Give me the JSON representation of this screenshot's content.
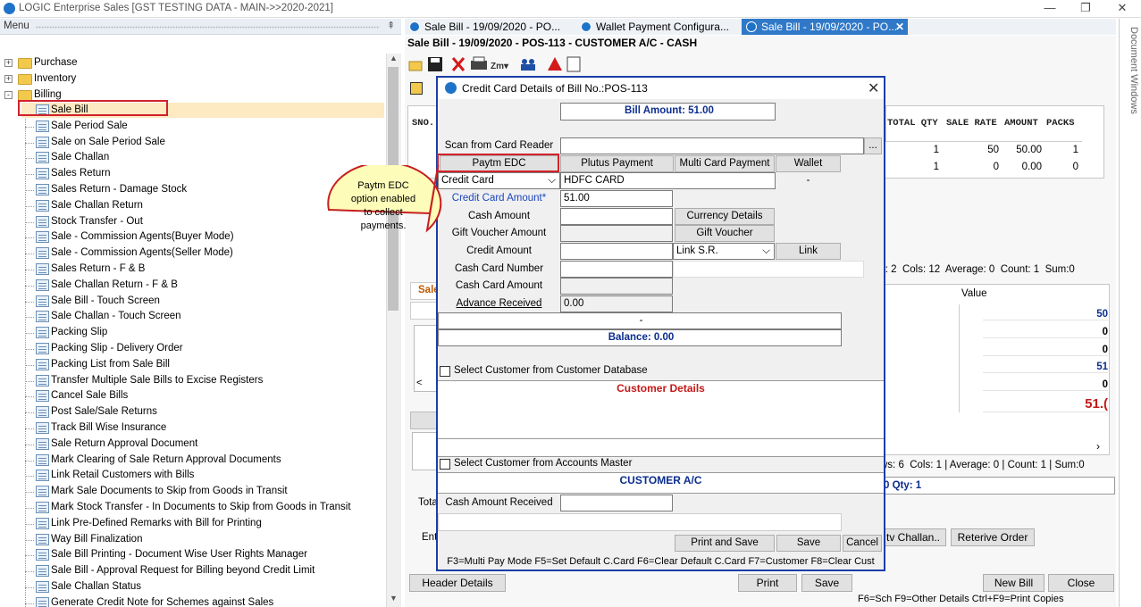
{
  "window": {
    "title": "LOGIC Enterprise Sales  [GST TESTING DATA - MAIN->>2020-2021]",
    "min": "—",
    "max": "❐",
    "close": "✕"
  },
  "menu": {
    "header": "Menu",
    "pin": "⇞",
    "groups": [
      {
        "label": "Purchase",
        "expander": "+"
      },
      {
        "label": "Inventory",
        "expander": "+"
      },
      {
        "label": "Billing",
        "expander": "-"
      }
    ],
    "items": [
      "Sale Bill",
      "Sale Period Sale",
      "Sale on Sale Period Sale",
      "Sale Challan",
      "Sales Return",
      "Sales Return - Damage Stock",
      "Sale Challan Return",
      "Stock Transfer - Out",
      "Sale - Commission Agents(Buyer Mode)",
      "Sale - Commission Agents(Seller Mode)",
      "Sales Return - F & B",
      "Sale Challan Return - F & B",
      "Sale Bill - Touch Screen",
      "Sale Challan - Touch Screen",
      "Packing Slip",
      "Packing Slip - Delivery Order",
      "Packing List from Sale Bill",
      "Transfer Multiple Sale Bills to Excise Registers",
      "Cancel Sale Bills",
      "Post Sale/Sale Returns",
      "Track Bill Wise Insurance",
      "Sale Return Approval Document",
      "Mark Clearing of Sale Return Approval Documents",
      "Link Retail Customers with Bills",
      "Mark Sale Documents to Skip from Goods in Transit",
      "Mark Stock Transfer - In Documents to Skip from Goods in Transit",
      "Link Pre-Defined Remarks with Bill for Printing",
      "Way Bill Finalization",
      "Sale Bill Printing - Document Wise User Rights Manager",
      "Sale Bill - Approval Request for Billing beyond Credit Limit",
      "Sale Challan Status",
      "Generate Credit Note for Schemes against Sales"
    ]
  },
  "tabs": [
    {
      "label": "Sale Bill - 19/09/2020 - PO..."
    },
    {
      "label": "Wallet Payment Configura..."
    },
    {
      "label": "Sale Bill - 19/09/2020 - PO...",
      "close": "✕"
    }
  ],
  "side_label": "Document Windows",
  "main": {
    "title": "Sale Bill - 19/09/2020 - POS-113  - CUSTOMER A/C - CASH",
    "grid": {
      "sno_header": "SNO.",
      "headers": [
        "TOTAL QTY",
        "SALE RATE",
        "AMOUNT",
        "PACKS"
      ],
      "rows": [
        {
          "total_qty": "1",
          "sale_rate": "50",
          "amount": "50.00",
          "packs": "1"
        },
        {
          "total_qty": "1",
          "sale_rate": "0",
          "amount": "0.00",
          "packs": "0"
        }
      ]
    },
    "status1": {
      "rows": "s: 2",
      "cols": "Cols: 12",
      "average": "Average: 0",
      "count": "Count: 1",
      "sum": "Sum:0"
    },
    "value_header": "Value",
    "values": [
      "50",
      "0",
      "0",
      "51",
      "0",
      "51.("
    ],
    "status2": {
      "rows": "ws: 6",
      "cols": "Cols: 1",
      "average": "Average: 0",
      "count": "Count: 1",
      "sum": "Sum:0"
    },
    "qty_text": "0   Qty:  1",
    "left_labels": {
      "sale_tab": "Sale",
      "tota": "Tota",
      "ent": "Ente"
    },
    "buttons": {
      "tv_challan": "tv Challan..",
      "retrieve_order": "Reterive Order",
      "header_details": "Header Details",
      "print": "Print",
      "save": "Save",
      "new_bill": "New Bill",
      "close": "Close"
    },
    "shortcuts": "F6=Sch  F9=Other Details  Ctrl+F9=Print Copies"
  },
  "dialog": {
    "title": "Credit Card Details of Bill No.:POS-113",
    "bill_amount": "Bill Amount: 51.00",
    "scan_label": "Scan from Card Reader",
    "scan_button": "...",
    "pay_buttons": {
      "paytm": "Paytm EDC",
      "plutus": "Plutus Payment",
      "multi": "Multi Card Payment",
      "wallet": "Wallet"
    },
    "card_type": "Credit Card",
    "card_name": "HDFC CARD",
    "dash_small": "-",
    "credit_card_amount_label": "Credit Card Amount*",
    "credit_card_amount": "51.00",
    "cash_amount_label": "Cash Amount",
    "currency_details": "Currency Details",
    "gift_voucher_amount_label": "Gift Voucher Amount",
    "gift_voucher": "Gift Voucher",
    "credit_amount_label": "Credit Amount",
    "link_sr": "Link S.R.",
    "link": "Link",
    "cash_card_number_label": "Cash Card Number",
    "cash_card_amount_label": "Cash Card Amount",
    "advance_received_label": "Advance Received",
    "advance_received": "0.00",
    "dash": "-",
    "balance": "Balance: 0.00",
    "select_customer_db": "Select Customer from Customer Database",
    "customer_details": "Customer Details",
    "select_customer_am": "Select Customer from Accounts Master",
    "customer_ac": "CUSTOMER A/C",
    "cash_amount_received_label": "Cash Amount Received",
    "buttons": {
      "print_save": "Print and Save",
      "save": "Save",
      "cancel": "Cancel"
    },
    "shortcuts": "F3=Multi Pay Mode  F5=Set Default C.Card   F6=Clear Default C.Card   F7=Customer F8=Clear Cust",
    "close": "✕"
  },
  "callout": {
    "lines": [
      "Paytm  EDC",
      "option  enabled",
      "to   collect",
      "payments."
    ]
  },
  "colors": {
    "accent": "#2f79c8",
    "dialog_border": "#1c3ea6",
    "highlight": "#d2222a",
    "callout_fill": "#fdfcb9",
    "callout_stroke": "#c61f1f",
    "dark_blue_text": "#0b2d8e",
    "red_text": "#c3191a"
  }
}
